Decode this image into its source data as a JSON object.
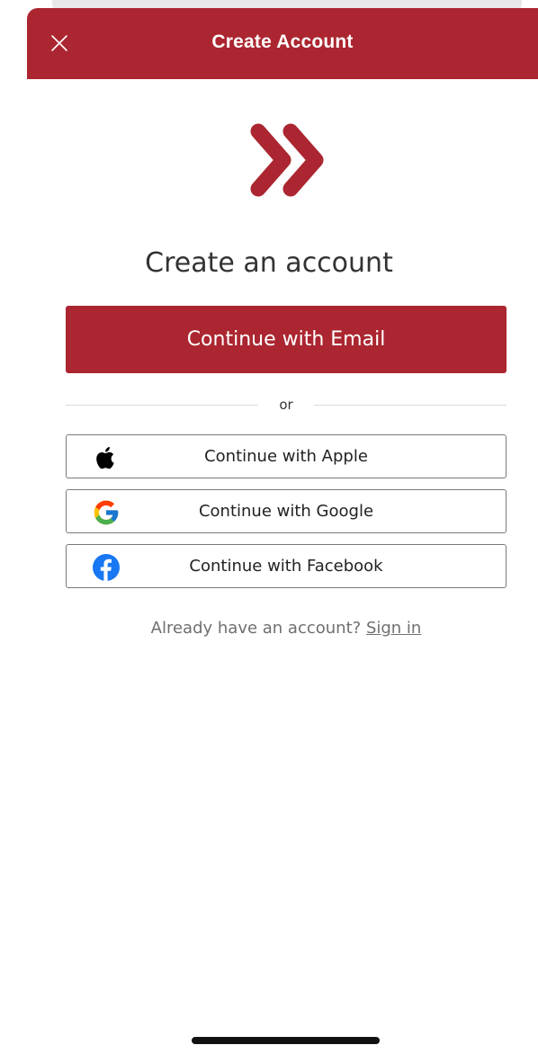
{
  "header": {
    "title": "Create Account",
    "close_icon": "close-icon"
  },
  "logo": {
    "icon": "double-chevron-logo",
    "color": "#ab2630"
  },
  "main": {
    "heading": "Create an account",
    "email_button_label": "Continue with Email",
    "divider_text": "or",
    "social_buttons": [
      {
        "label": "Continue with Apple",
        "icon": "apple-icon"
      },
      {
        "label": "Continue with Google",
        "icon": "google-icon"
      },
      {
        "label": "Continue with Facebook",
        "icon": "facebook-icon"
      }
    ],
    "signin_prompt": "Already have an account?",
    "signin_link": "Sign in"
  },
  "colors": {
    "brand": "#ab2630",
    "text": "#333333",
    "muted": "#6f6f6f",
    "facebook": "#1877f2"
  }
}
